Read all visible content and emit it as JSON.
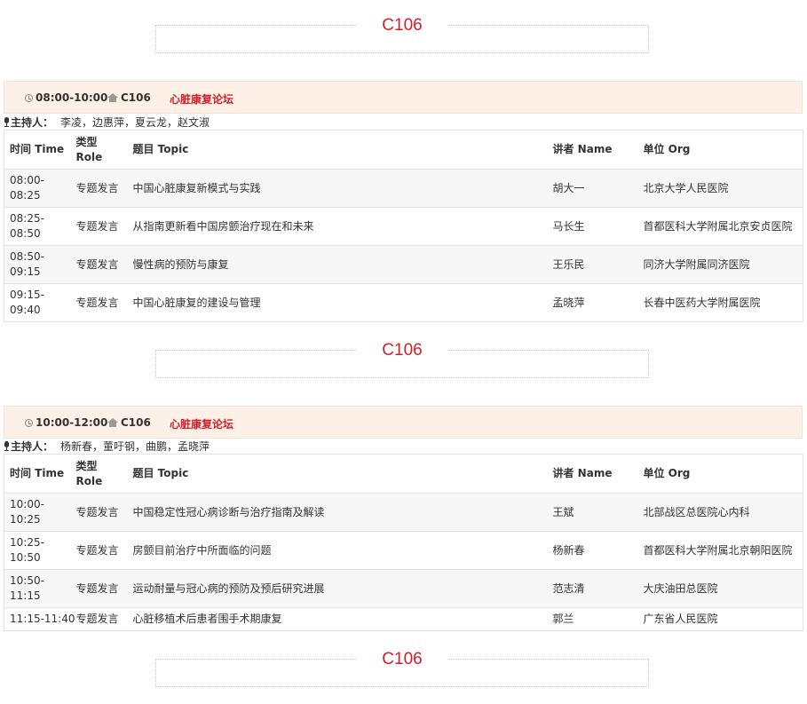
{
  "room_label": "C106",
  "columns": {
    "time": "时间 Time",
    "role": "类型 Role",
    "topic": "题目 Topic",
    "speaker": "讲者 Name",
    "org": "单位 Org"
  },
  "moderator_label": "主持人：",
  "sessions": [
    {
      "time": "08:00-10:00",
      "room": "C106",
      "title": "心脏康复论坛",
      "moderators": "李凌，边惠萍，夏云龙，赵文淑",
      "rows": [
        {
          "time": "08:00-08:25",
          "role": "专题发言",
          "topic": "中国心脏康复新模式与实践",
          "speaker": "胡大一",
          "org": "北京大学人民医院"
        },
        {
          "time": "08:25-08:50",
          "role": "专题发言",
          "topic": "从指南更新看中国房颤治疗现在和未来",
          "speaker": "马长生",
          "org": "首都医科大学附属北京安贞医院"
        },
        {
          "time": "08:50-09:15",
          "role": "专题发言",
          "topic": "慢性病的预防与康复",
          "speaker": "王乐民",
          "org": "同济大学附属同济医院"
        },
        {
          "time": "09:15-09:40",
          "role": "专题发言",
          "topic": "中国心脏康复的建设与管理",
          "speaker": "孟晓萍",
          "org": "长春中医药大学附属医院"
        }
      ]
    },
    {
      "time": "10:00-12:00",
      "room": "C106",
      "title": "心脏康复论坛",
      "moderators": "杨新春，董吁钢，曲鹏，孟晓萍",
      "rows": [
        {
          "time": "10:00-10:25",
          "role": "专题发言",
          "topic": "中国稳定性冠心病诊断与治疗指南及解读",
          "speaker": "王斌",
          "org": "北部战区总医院心内科"
        },
        {
          "time": "10:25-10:50",
          "role": "专题发言",
          "topic": "房颤目前治疗中所面临的问题",
          "speaker": "杨新春",
          "org": "首都医科大学附属北京朝阳医院"
        },
        {
          "time": "10:50-11:15",
          "role": "专题发言",
          "topic": "运动耐量与冠心病的预防及预后研究进展",
          "speaker": "范志清",
          "org": "大庆油田总医院"
        },
        {
          "time": "11:15-11:40",
          "role": "专题发言",
          "topic": "心脏移植术后患者围手术期康复",
          "speaker": "郭兰",
          "org": "广东省人民医院"
        }
      ]
    }
  ]
}
